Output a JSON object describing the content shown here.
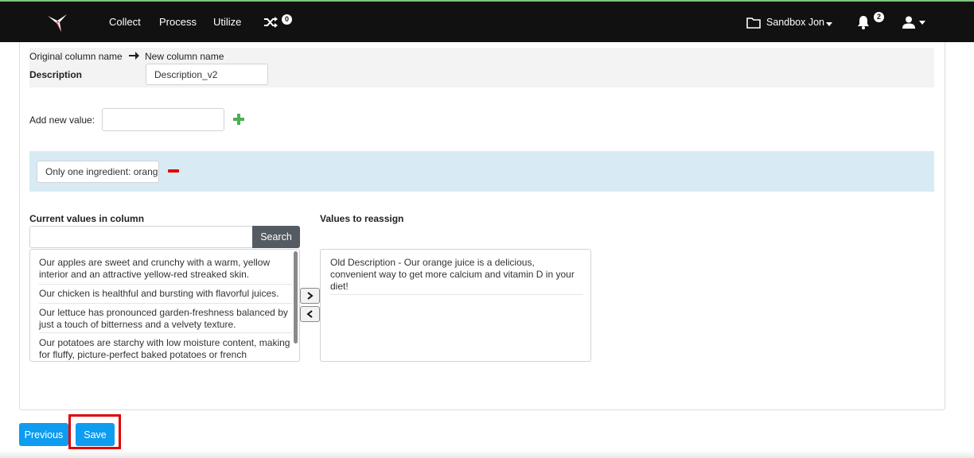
{
  "navbar": {
    "items": [
      {
        "label": "Collect"
      },
      {
        "label": "Process"
      },
      {
        "label": "Utilize"
      }
    ],
    "shuffle_badge": "0",
    "workspace": "Sandbox Jon",
    "notifications_badge": "2"
  },
  "rename": {
    "original_label": "Original column name",
    "new_label": "New column name",
    "column_name": "Description",
    "new_value": "Description_v2"
  },
  "add_value": {
    "label": "Add new value:",
    "value": ""
  },
  "new_value_chip": "Only one ingredient: orange",
  "current_values": {
    "heading": "Current values in column",
    "search_value": "",
    "search_button": "Search",
    "items": [
      "Our apples are sweet and crunchy with a warm, yellow interior and an attractive yellow-red streaked skin.",
      "Our chicken is healthful and bursting with flavorful juices.",
      "Our lettuce has pronounced garden-freshness balanced by just a touch of bitterness and a velvety texture.",
      "Our potatoes are starchy with low moisture content, making for fluffy, picture-perfect baked potatoes or french"
    ]
  },
  "reassign": {
    "heading": "Values to reassign",
    "items": [
      "Old Description - Our orange juice is a delicious, convenient way to get more calcium and vitamin D in your diet!"
    ]
  },
  "footer": {
    "previous": "Previous",
    "save": "Save"
  },
  "colors": {
    "primary": "#0d9cf0",
    "highlight": "#e00000",
    "add": "#4caf50",
    "navbar": "#111111"
  }
}
